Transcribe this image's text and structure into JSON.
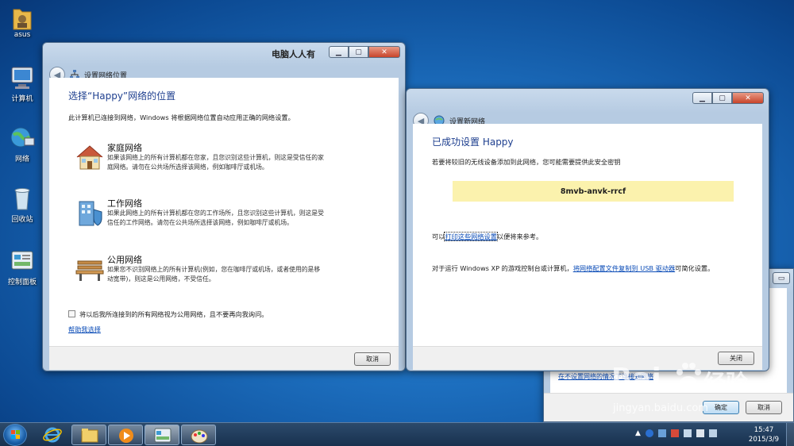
{
  "desktop": {
    "icons": [
      {
        "label": "asus"
      },
      {
        "label": "计算机"
      },
      {
        "label": "网络"
      },
      {
        "label": "回收站"
      },
      {
        "label": "控制面板"
      }
    ]
  },
  "window_location": {
    "title": "设置网络位置",
    "watermark": "电脑人人有",
    "heading": "选择“Happy”网络的位置",
    "intro": "此计算机已连接到网络，Windows 将根据网络位置自动应用正确的网络设置。",
    "options": [
      {
        "title": "家庭网络",
        "desc1": "如果该网络上的所有计算机都在您家，且您识别这些计算机，则这是受信任的家",
        "desc2": "庭网络。请勿在公共场所选择该网络，例如咖啡厅或机场。"
      },
      {
        "title": "工作网络",
        "desc1": "如果此网络上的所有计算机都在您的工作场所，且您识别这些计算机，则这是受",
        "desc2": "信任的工作网络。请勿在公共场所选择该网络，例如咖啡厅或机场。"
      },
      {
        "title": "公用网络",
        "desc1": "如果您不识别网络上的所有计算机(例如，您在咖啡厅或机场，或者使用的是移",
        "desc2": "动宽带)，则这是公用网络，不受信任。"
      }
    ],
    "checkbox_label": "将以后我所连接到的所有网络视为公用网络，且不要再向我询问。",
    "help_link": "帮助我选择",
    "cancel": "取消"
  },
  "window_new": {
    "title": "设置新网络",
    "heading": "已成功设置 Happy",
    "instruction": "若要将较旧的无线设备添加到此网络，您可能需要提供此安全密钥",
    "key": "8mvb-anvk-rrcf",
    "print_prefix": "可以",
    "print_link": "打印这些网络设置",
    "print_suffix": "以便将来参考。",
    "xp_prefix": "对于运行 Windows XP 的游戏控制台或计算机，",
    "xp_link": "将网络配置文件复制到 USB 驱动器",
    "xp_suffix": "可简化设置。",
    "close": "关闭"
  },
  "window_back": {
    "link": "在不设置网络的情况下连接到网络",
    "ok": "确定",
    "cancel": "取消"
  },
  "watermark": {
    "brand": "Bai",
    "brand2": "经验",
    "url": "jingyan.baidu.com"
  },
  "taskbar": {
    "time": "15:47",
    "date": "2015/3/9"
  }
}
